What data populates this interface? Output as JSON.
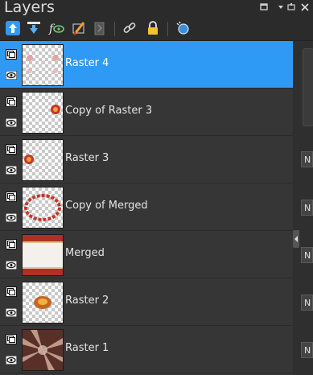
{
  "panel": {
    "title": "Layers"
  },
  "window_controls": [
    "close-icon",
    "menu-arrow-icon",
    "pin-icon"
  ],
  "toolbar": {
    "buttons": [
      "move-layer-up-icon",
      "move-layer-down-icon",
      "visibility-toggle-icon",
      "edit-brush-icon",
      "delete-layer-icon",
      "link-icon",
      "lock-icon",
      "blend-icon"
    ]
  },
  "layers": [
    {
      "name": "Raster 4",
      "selected": true
    },
    {
      "name": "Copy of Raster 3",
      "selected": false
    },
    {
      "name": "Raster 3",
      "selected": false
    },
    {
      "name": "Copy of Merged",
      "selected": false
    },
    {
      "name": "Merged",
      "selected": false
    },
    {
      "name": "Raster 2",
      "selected": false
    },
    {
      "name": "Raster 1",
      "selected": false
    }
  ],
  "blend_mode_buttons": [
    "N",
    "N",
    "N",
    "N",
    "N",
    "N"
  ],
  "colors": {
    "selected": "#2e9af5",
    "panel": "#363636",
    "toolbar": "#2b2b2b",
    "accent_red": "#c0392b"
  }
}
